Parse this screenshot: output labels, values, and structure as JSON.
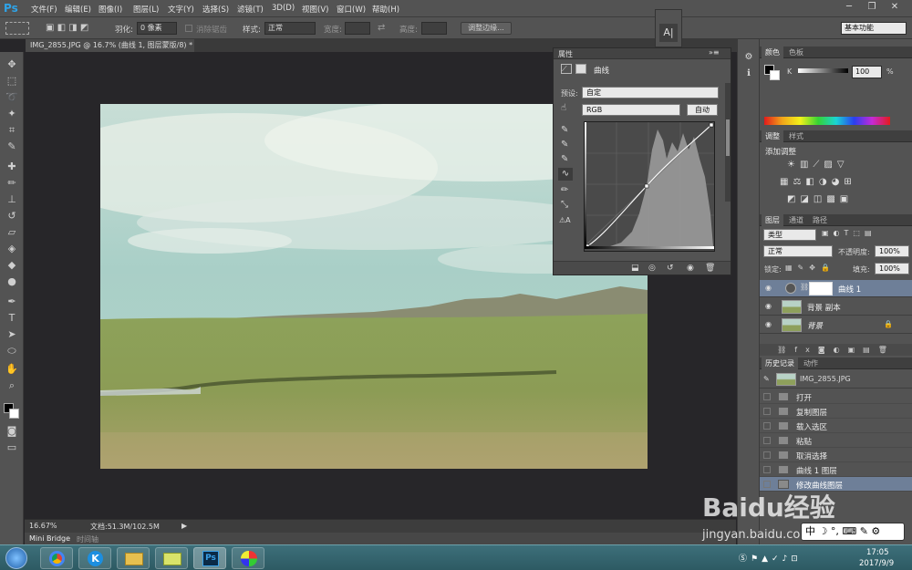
{
  "app": {
    "logo": "Ps"
  },
  "menu": [
    "文件(F)",
    "编辑(E)",
    "图像(I)",
    "图层(L)",
    "文字(Y)",
    "选择(S)",
    "滤镜(T)",
    "3D(D)",
    "视图(V)",
    "窗口(W)",
    "帮助(H)"
  ],
  "options": {
    "feather_label": "羽化:",
    "feather_value": "0 像素",
    "antialias_label": "消除锯齿",
    "style_label": "样式:",
    "style_value": "正常",
    "width_label": "宽度:",
    "height_label": "高度:",
    "refine_button": "调整边缘...",
    "workspace": "基本功能"
  },
  "document": {
    "tab_title": "IMG_2855.JPG @ 16.7% (曲线 1, 图层蒙版/8) *",
    "zoom": "16.67%",
    "doc_size": "文档:51.3M/102.5M"
  },
  "bottom_tabs": [
    "Mini Bridge",
    "时间轴"
  ],
  "properties": {
    "panel_title": "属性",
    "adjust_name": "曲线",
    "preset_label": "预设:",
    "preset_value": "自定",
    "channel_value": "RGB",
    "auto_button": "自动"
  },
  "color_panel": {
    "tabs": [
      "颜色",
      "色板"
    ],
    "channel_label": "K",
    "k_value": "100",
    "unit": "%"
  },
  "adjust_panel": {
    "tabs": [
      "调整",
      "样式"
    ],
    "heading": "添加调整"
  },
  "layers_panel": {
    "tabs": [
      "图层",
      "通道",
      "路径"
    ],
    "filter_label": "类型",
    "blend_mode": "正常",
    "opacity_label": "不透明度:",
    "opacity_value": "100%",
    "lock_label": "锁定:",
    "fill_label": "填充:",
    "fill_value": "100%",
    "layers": [
      {
        "name": "曲线 1",
        "selected": true
      },
      {
        "name": "背景 副本",
        "selected": false
      },
      {
        "name": "背景",
        "selected": false
      }
    ]
  },
  "history_panel": {
    "tabs": [
      "历史记录",
      "动作"
    ],
    "snapshot": "IMG_2855.JPG",
    "items": [
      "打开",
      "复制图层",
      "载入选区",
      "粘贴",
      "取消选择",
      "曲线 1 图层",
      "修改曲线图层"
    ]
  },
  "watermark": {
    "brand": "Baidu经验",
    "url": "jingyan.baidu.com"
  },
  "taskbar": {
    "time": "17:05",
    "date": "2017/9/9",
    "ime": "中"
  }
}
